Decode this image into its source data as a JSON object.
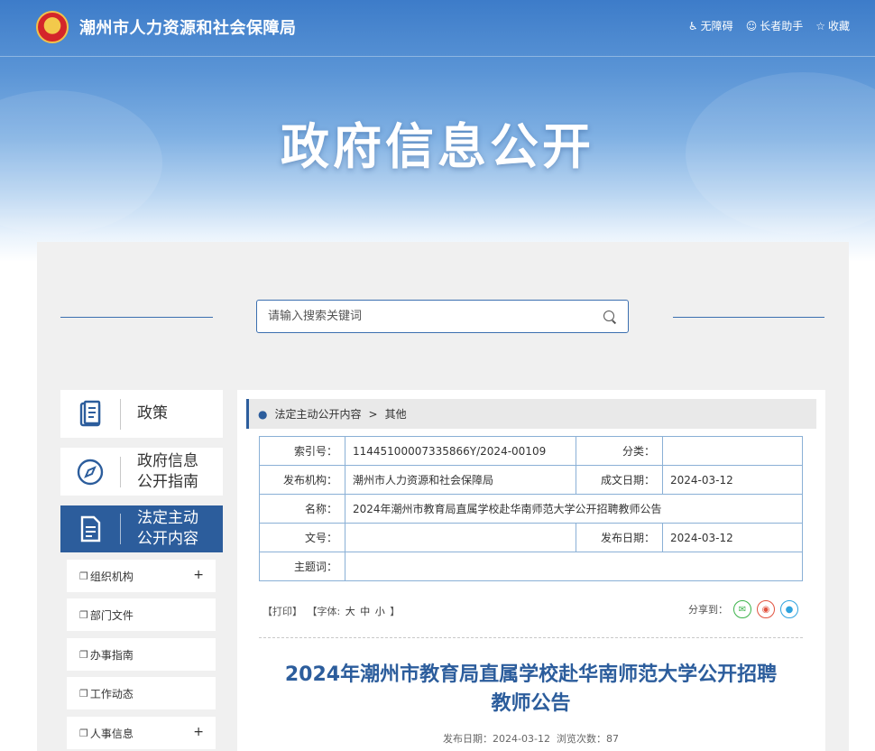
{
  "header": {
    "site_name": "潮州市人力资源和社会保障局",
    "links": [
      {
        "icon": "wheelchair-icon",
        "label": "无障碍"
      },
      {
        "icon": "elder-assistant-icon",
        "label": "长者助手"
      },
      {
        "icon": "star-icon",
        "label": "收藏"
      }
    ],
    "banner_title": "政府信息公开"
  },
  "search": {
    "placeholder": "请输入搜索关键词"
  },
  "sidebar": {
    "cards": [
      {
        "icon": "book-icon",
        "label": "政策"
      },
      {
        "icon": "compass-icon",
        "label_line1": "政府信息",
        "label_line2": "公开指南"
      },
      {
        "icon": "document-icon",
        "label_line1": "法定主动",
        "label_line2": "公开内容"
      }
    ],
    "sub_items": [
      {
        "label": "组织机构",
        "expandable": "+"
      },
      {
        "label": "部门文件"
      },
      {
        "label": "办事指南"
      },
      {
        "label": "工作动态"
      },
      {
        "label": "人事信息",
        "expandable": "+"
      }
    ]
  },
  "breadcrumb": {
    "level1": "法定主动公开内容",
    "separator": ">",
    "level2": "其他"
  },
  "meta_table": {
    "index_label": "索引号：",
    "index_value": "11445100007335866Y/2024-00109",
    "category_label": "分类：",
    "category_value": "",
    "publisher_label": "发布机构：",
    "publisher_value": "潮州市人力资源和社会保障局",
    "created_label": "成文日期：",
    "created_value": "2024-03-12",
    "name_label": "名称：",
    "name_value": "2024年潮州市教育局直属学校赴华南师范大学公开招聘教师公告",
    "docno_label": "文号：",
    "docno_value": "",
    "published_label": "发布日期：",
    "published_value": "2024-03-12",
    "subject_label": "主题词：",
    "subject_value": ""
  },
  "tools": {
    "print": "【打印】",
    "font_prefix": "【字体:",
    "font_large": "大",
    "font_medium": "中",
    "font_small": "小",
    "font_suffix": "】"
  },
  "share": {
    "label": "分享到：",
    "wechat_icon": "wechat-icon",
    "weibo_icon": "weibo-icon",
    "qq_icon": "qq-icon"
  },
  "article": {
    "title_line1": "2024年潮州市教育局直属学校赴华南师范大学公开招聘",
    "title_line2": "教师公告",
    "date_label": "发布日期：",
    "date_value": "2024-03-12",
    "views_label": "浏览次数：",
    "views_value": "87"
  },
  "colors": {
    "brand": "#2c5d9c",
    "panel_bg": "#f0f0f0",
    "table_border": "#8ab0d6"
  }
}
